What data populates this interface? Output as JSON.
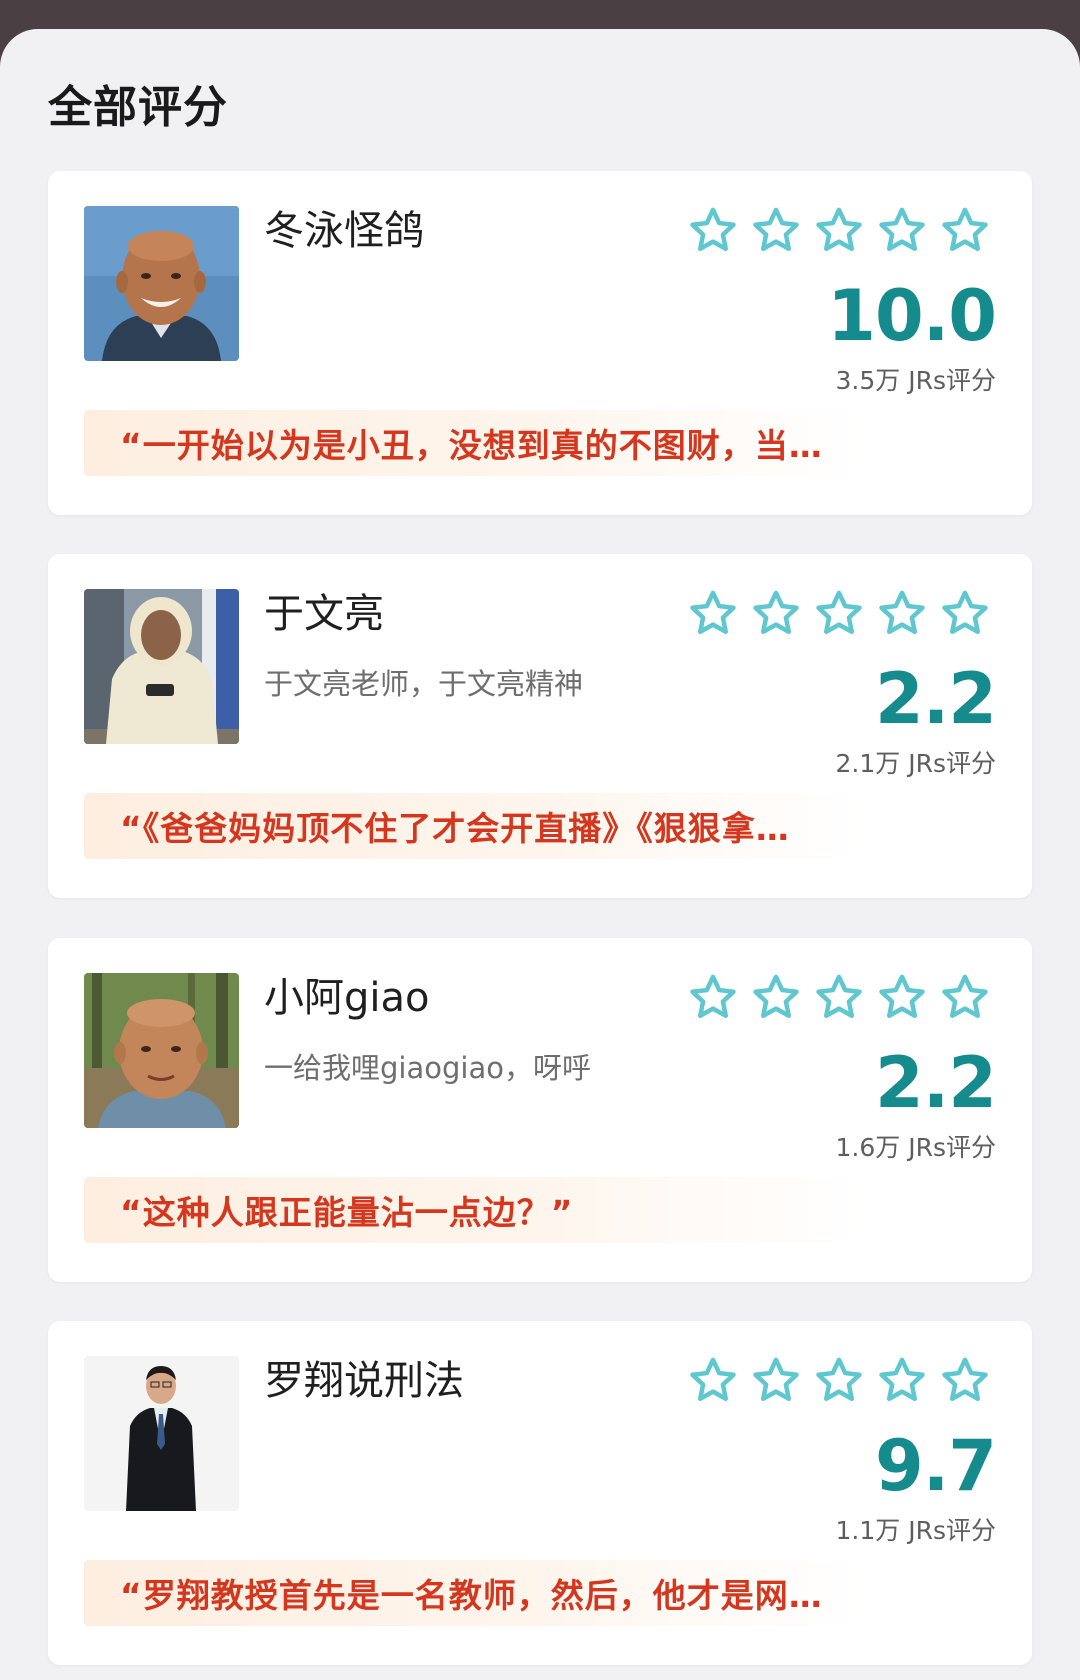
{
  "header": {
    "title": "全部评分"
  },
  "colors": {
    "score": "#168b8e",
    "star_outline": "#5ec7cf",
    "quote_text": "#d5371e",
    "quote_bg": "#fdeee0"
  },
  "star_icon": "star-outline-icon",
  "cards": [
    {
      "name": "冬泳怪鸽",
      "subtitle": "",
      "score": "10.0",
      "count": "3.5万 JRs评分",
      "quote": "“一开始以为是小丑，没想到真的不图财，当…"
    },
    {
      "name": "于文亮",
      "subtitle": "于文亮老师，于文亮精神",
      "score": "2.2",
      "count": "2.1万 JRs评分",
      "quote": "“《爸爸妈妈顶不住了才会开直播》《狠狠拿…"
    },
    {
      "name": "小阿giao",
      "subtitle": "一给我哩giaogiao，呀呼",
      "score": "2.2",
      "count": "1.6万 JRs评分",
      "quote": "“这种人跟正能量沾一点边？”"
    },
    {
      "name": "罗翔说刑法",
      "subtitle": "",
      "score": "9.7",
      "count": "1.1万 JRs评分",
      "quote": "“罗翔教授首先是一名教师，然后，他才是网…"
    }
  ]
}
